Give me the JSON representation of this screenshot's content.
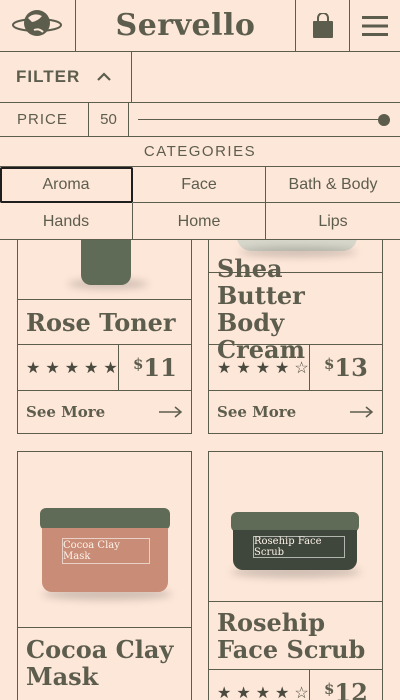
{
  "header": {
    "brand": "Servello",
    "logo_icon": "globe-leaf-logo-icon",
    "bag_icon": "shopping-bag-icon",
    "menu_icon": "hamburger-menu-icon"
  },
  "filter": {
    "label": "FILTER",
    "toggle_icon": "chevron-up-icon"
  },
  "price": {
    "label": "PRICE",
    "value": "50",
    "slider_level": 1.0
  },
  "categories": {
    "title": "CATEGORIES",
    "items": [
      {
        "label": "Aroma",
        "active": true
      },
      {
        "label": "Face",
        "active": false
      },
      {
        "label": "Bath & Body",
        "active": false
      },
      {
        "label": "Hands",
        "active": false
      },
      {
        "label": "Home",
        "active": false
      },
      {
        "label": "Lips",
        "active": false
      }
    ]
  },
  "products": [
    {
      "name": "Rose Toner",
      "rating": 5,
      "price": "11",
      "currency": "$",
      "cta": "See More",
      "jar_label": ""
    },
    {
      "name": "Shea Butter Body Cream",
      "rating": 4,
      "price": "13",
      "currency": "$",
      "cta": "See More",
      "jar_label": ""
    },
    {
      "name": "Cocoa Clay Mask",
      "rating": 0,
      "price": "",
      "currency": "",
      "cta": "",
      "jar_label": "Cocoa Clay Mask"
    },
    {
      "name": "Rosehip Face Scrub",
      "rating": 4,
      "price": "12",
      "currency": "$",
      "cta": "",
      "jar_label": "Rosehip Face Scrub"
    }
  ],
  "colors": {
    "background": "#fde7d9",
    "ink": "#5d5d4e",
    "jar_lid": "#5f6b57",
    "clay_body": "#c98c77",
    "scrub_body": "#3f463b"
  }
}
